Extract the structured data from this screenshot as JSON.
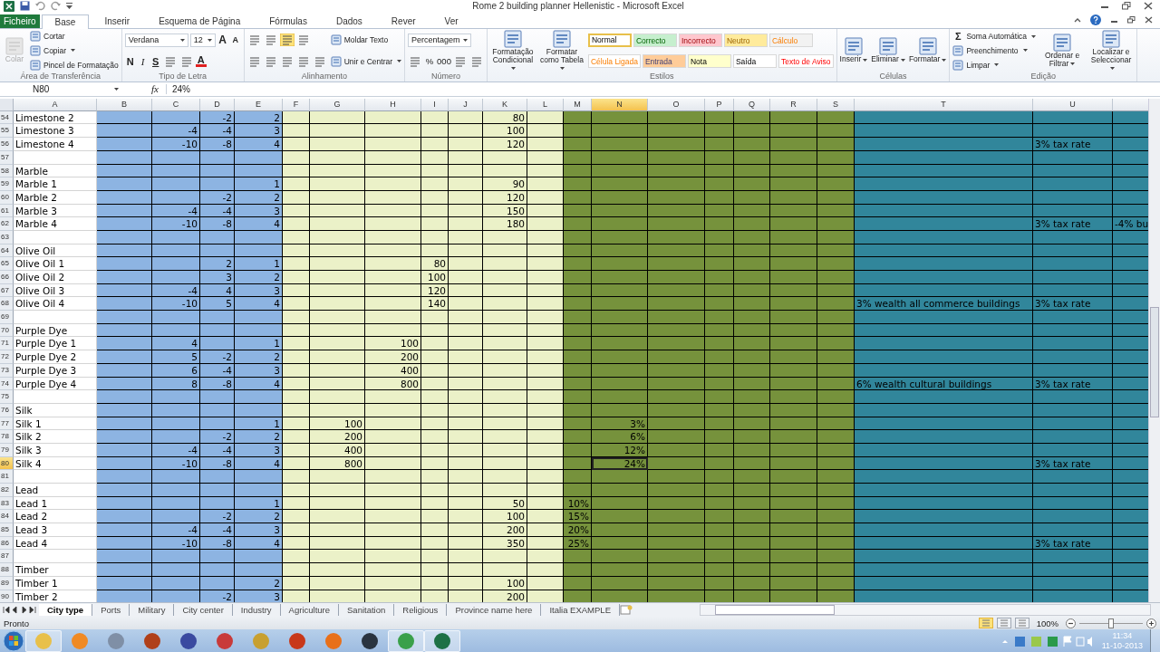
{
  "window": {
    "title": "Rome 2 building planner Hellenistic  -  Microsoft Excel"
  },
  "ribbon_tabs": [
    {
      "label": "Ficheiro",
      "kind": "file",
      "selected": false
    },
    {
      "label": "Base",
      "kind": "tab",
      "selected": true
    },
    {
      "label": "Inserir",
      "kind": "tab",
      "selected": false
    },
    {
      "label": "Esquema de Página",
      "kind": "tab",
      "selected": false
    },
    {
      "label": "Fórmulas",
      "kind": "tab",
      "selected": false
    },
    {
      "label": "Dados",
      "kind": "tab",
      "selected": false
    },
    {
      "label": "Rever",
      "kind": "tab",
      "selected": false
    },
    {
      "label": "Ver",
      "kind": "tab",
      "selected": false
    }
  ],
  "ribbon_groups": [
    {
      "label": "Área de Transferência",
      "columns": [
        [
          [
            {
              "kind": "large",
              "label": "Colar",
              "disabled": true
            }
          ]
        ],
        [
          [
            {
              "kind": "small",
              "label": "Cortar"
            }
          ],
          [
            {
              "kind": "small",
              "label": "Copiar",
              "menu": true
            }
          ],
          [
            {
              "kind": "small",
              "label": "Pincel de Formatação"
            }
          ]
        ]
      ]
    },
    {
      "label": "Tipo de Letra",
      "columns": [
        [
          [
            {
              "kind": "dropdown",
              "value": "Verdana",
              "wide": true
            },
            {
              "kind": "dropdown",
              "value": "12"
            },
            {
              "kind": "grow",
              "label": "A"
            },
            {
              "kind": "shrink",
              "label": "A"
            }
          ],
          [
            {
              "kind": "bold",
              "label": "N"
            },
            {
              "kind": "italic",
              "label": "I"
            },
            {
              "kind": "underline",
              "label": "S"
            },
            {
              "kind": "icon"
            },
            {
              "kind": "icon"
            },
            {
              "kind": "fontcolor",
              "label": "A"
            }
          ]
        ]
      ]
    },
    {
      "label": "Alinhamento",
      "columns": [
        [
          [
            {
              "kind": "icon",
              "selected": false
            },
            {
              "kind": "icon",
              "selected": false
            },
            {
              "kind": "icon",
              "selected": true
            },
            {
              "kind": "icon",
              "selected": false
            }
          ],
          [
            {
              "kind": "icon",
              "selected": false
            },
            {
              "kind": "icon",
              "selected": false
            },
            {
              "kind": "icon",
              "selected": false
            },
            {
              "kind": "icon",
              "selected": false
            },
            {
              "kind": "icon",
              "selected": false
            }
          ]
        ],
        [
          [
            {
              "kind": "small",
              "label": "Moldar Texto"
            }
          ],
          [
            {
              "kind": "small",
              "label": "Unir e Centrar",
              "menu": true
            }
          ]
        ]
      ]
    },
    {
      "label": "Número",
      "columns": [
        [
          [
            {
              "kind": "dropdown",
              "value": "Percentagem",
              "wide": true
            }
          ],
          [
            {
              "kind": "icon"
            },
            {
              "kind": "glyph",
              "label": "%"
            },
            {
              "kind": "glyph",
              "label": "000"
            },
            {
              "kind": "icon"
            },
            {
              "kind": "icon"
            }
          ]
        ]
      ]
    },
    {
      "label": "Estilos",
      "columns": [
        [
          [
            {
              "kind": "large",
              "label": "Formatação Condicional",
              "menu": true
            }
          ]
        ],
        [
          [
            {
              "kind": "large",
              "label": "Formatar como Tabela",
              "menu": true
            }
          ]
        ],
        [
          [
            {
              "kind": "style",
              "label": "Normal",
              "color": "#ffffff",
              "selected": true
            },
            {
              "kind": "style",
              "label": "Correcto",
              "color": "#c6efce",
              "selected": false
            },
            {
              "kind": "style",
              "label": "Incorrecto",
              "color": "#ffc7ce",
              "selected": false
            },
            {
              "kind": "style",
              "label": "Neutro",
              "color": "#ffeb9c",
              "selected": false
            },
            {
              "kind": "style",
              "label": "Cálculo",
              "color": "#f2f2f2",
              "selected": false
            }
          ],
          [
            {
              "kind": "style",
              "label": "Célula Ligada",
              "color": "#ffffff",
              "selected": false
            },
            {
              "kind": "style",
              "label": "Entrada",
              "color": "#ffcc99",
              "selected": false
            },
            {
              "kind": "style",
              "label": "Nota",
              "color": "#ffffcc",
              "selected": false
            },
            {
              "kind": "style",
              "label": "Saída",
              "color": "#ffffff",
              "selected": false
            },
            {
              "kind": "style",
              "label": "Texto de Aviso",
              "color": "#ffffff",
              "selected": false
            }
          ]
        ]
      ]
    },
    {
      "label": "Células",
      "columns": [
        [
          [
            {
              "kind": "large",
              "label": "Inserir",
              "menu": true
            }
          ]
        ],
        [
          [
            {
              "kind": "large",
              "label": "Eliminar",
              "menu": true
            }
          ]
        ],
        [
          [
            {
              "kind": "large",
              "label": "Formatar",
              "menu": true
            }
          ]
        ]
      ]
    },
    {
      "label": "Edição",
      "columns": [
        [
          [
            {
              "kind": "small",
              "label": "Soma Automática",
              "glyph": "Σ",
              "menu": true
            }
          ],
          [
            {
              "kind": "small",
              "label": "Preenchimento",
              "menu": true
            }
          ],
          [
            {
              "kind": "small",
              "label": "Limpar",
              "menu": true
            }
          ]
        ],
        [
          [
            {
              "kind": "large",
              "label": "Ordenar e Filtrar",
              "menu": true
            }
          ]
        ],
        [
          [
            {
              "kind": "large",
              "label": "Localizar e Seleccionar",
              "menu": true
            }
          ]
        ]
      ]
    }
  ],
  "formula_bar": {
    "name_box": "N80",
    "fx": "fx",
    "formula": "24%"
  },
  "columns": [
    {
      "label": "A",
      "selected": false
    },
    {
      "label": "B",
      "selected": false
    },
    {
      "label": "C",
      "selected": false
    },
    {
      "label": "D",
      "selected": false
    },
    {
      "label": "E",
      "selected": false
    },
    {
      "label": "F",
      "selected": false
    },
    {
      "label": "G",
      "selected": false
    },
    {
      "label": "H",
      "selected": false
    },
    {
      "label": "I",
      "selected": false
    },
    {
      "label": "J",
      "selected": false
    },
    {
      "label": "K",
      "selected": false
    },
    {
      "label": "L",
      "selected": false
    },
    {
      "label": "M",
      "selected": false
    },
    {
      "label": "N",
      "selected": true
    },
    {
      "label": "O",
      "selected": false
    },
    {
      "label": "P",
      "selected": false
    },
    {
      "label": "Q",
      "selected": false
    },
    {
      "label": "R",
      "selected": false
    },
    {
      "label": "S",
      "selected": false
    },
    {
      "label": "T",
      "selected": false
    },
    {
      "label": "U",
      "selected": false
    }
  ],
  "rows": [
    {
      "n": "54",
      "selected": false,
      "cells": {
        "A": "Limestone 2",
        "D": "-2",
        "E": "2",
        "K": "80"
      }
    },
    {
      "n": "55",
      "selected": false,
      "cells": {
        "A": "Limestone 3",
        "C": "-4",
        "D": "-4",
        "E": "3",
        "K": "100"
      }
    },
    {
      "n": "56",
      "selected": false,
      "cells": {
        "A": "Limestone 4",
        "C": "-10",
        "D": "-8",
        "E": "4",
        "K": "120",
        "U": "3% tax rate"
      }
    },
    {
      "n": "57",
      "selected": false,
      "cells": {}
    },
    {
      "n": "58",
      "selected": false,
      "cells": {
        "A": "Marble"
      }
    },
    {
      "n": "59",
      "selected": false,
      "cells": {
        "A": "Marble 1",
        "E": "1",
        "K": "90"
      }
    },
    {
      "n": "60",
      "selected": false,
      "cells": {
        "A": "Marble 2",
        "D": "-2",
        "E": "2",
        "K": "120"
      }
    },
    {
      "n": "61",
      "selected": false,
      "cells": {
        "A": "Marble 3",
        "C": "-4",
        "D": "-4",
        "E": "3",
        "K": "150"
      }
    },
    {
      "n": "62",
      "selected": false,
      "cells": {
        "A": "Marble 4",
        "C": "-10",
        "D": "-8",
        "E": "4",
        "K": "180",
        "U": "3% tax rate",
        "column_22": "-4% bu"
      }
    },
    {
      "n": "63",
      "selected": false,
      "cells": {}
    },
    {
      "n": "64",
      "selected": false,
      "cells": {
        "A": "Olive Oil"
      }
    },
    {
      "n": "65",
      "selected": false,
      "cells": {
        "A": "Olive Oil 1",
        "D": "2",
        "E": "1",
        "I": "80"
      }
    },
    {
      "n": "66",
      "selected": false,
      "cells": {
        "A": "Olive Oil 2",
        "D": "3",
        "E": "2",
        "I": "100"
      }
    },
    {
      "n": "67",
      "selected": false,
      "cells": {
        "A": "Olive Oil 3",
        "C": "-4",
        "D": "4",
        "E": "3",
        "I": "120"
      }
    },
    {
      "n": "68",
      "selected": false,
      "cells": {
        "A": "Olive Oil 4",
        "C": "-10",
        "D": "5",
        "E": "4",
        "I": "140",
        "T": "3% wealth all commerce buildings",
        "U": "3% tax rate"
      }
    },
    {
      "n": "69",
      "selected": false,
      "cells": {}
    },
    {
      "n": "70",
      "selected": false,
      "cells": {
        "A": "Purple Dye"
      }
    },
    {
      "n": "71",
      "selected": false,
      "cells": {
        "A": "Purple Dye 1",
        "C": "4",
        "E": "1",
        "H": "100"
      }
    },
    {
      "n": "72",
      "selected": false,
      "cells": {
        "A": "Purple Dye 2",
        "C": "5",
        "D": "-2",
        "E": "2",
        "H": "200"
      }
    },
    {
      "n": "73",
      "selected": false,
      "cells": {
        "A": "Purple Dye 3",
        "C": "6",
        "D": "-4",
        "E": "3",
        "H": "400"
      }
    },
    {
      "n": "74",
      "selected": false,
      "cells": {
        "A": "Purple Dye 4",
        "C": "8",
        "D": "-8",
        "E": "4",
        "H": "800",
        "T": "6% wealth cultural buildings",
        "U": "3% tax rate"
      }
    },
    {
      "n": "75",
      "selected": false,
      "cells": {}
    },
    {
      "n": "76",
      "selected": false,
      "cells": {
        "A": "Silk"
      }
    },
    {
      "n": "77",
      "selected": false,
      "cells": {
        "A": "Silk 1",
        "E": "1",
        "G": "100",
        "N": "3%"
      }
    },
    {
      "n": "78",
      "selected": false,
      "cells": {
        "A": "Silk 2",
        "D": "-2",
        "E": "2",
        "G": "200",
        "N": "6%"
      }
    },
    {
      "n": "79",
      "selected": false,
      "cells": {
        "A": "Silk 3",
        "C": "-4",
        "D": "-4",
        "E": "3",
        "G": "400",
        "N": "12%"
      }
    },
    {
      "n": "80",
      "selected": true,
      "cells": {
        "A": "Silk 4",
        "C": "-10",
        "D": "-8",
        "E": "4",
        "G": "800",
        "N": "24%",
        "U": "3% tax rate"
      }
    },
    {
      "n": "81",
      "selected": false,
      "cells": {}
    },
    {
      "n": "82",
      "selected": false,
      "cells": {
        "A": "Lead"
      }
    },
    {
      "n": "83",
      "selected": false,
      "cells": {
        "A": "Lead 1",
        "E": "1",
        "K": "50",
        "M": "10%"
      }
    },
    {
      "n": "84",
      "selected": false,
      "cells": {
        "A": "Lead 2",
        "D": "-2",
        "E": "2",
        "K": "100",
        "M": "15%"
      }
    },
    {
      "n": "85",
      "selected": false,
      "cells": {
        "A": "Lead 3",
        "C": "-4",
        "D": "-4",
        "E": "3",
        "K": "200",
        "M": "20%"
      }
    },
    {
      "n": "86",
      "selected": false,
      "cells": {
        "A": "Lead 4",
        "C": "-10",
        "D": "-8",
        "E": "4",
        "K": "350",
        "M": "25%",
        "U": "3% tax rate"
      }
    },
    {
      "n": "87",
      "selected": false,
      "cells": {}
    },
    {
      "n": "88",
      "selected": false,
      "cells": {
        "A": "Timber"
      }
    },
    {
      "n": "89",
      "selected": false,
      "cells": {
        "A": "Timber 1",
        "E": "2",
        "K": "100"
      }
    },
    {
      "n": "90",
      "selected": false,
      "cells": {
        "A": "Timber 2",
        "D": "-2",
        "E": "3",
        "K": "200"
      }
    }
  ],
  "sheet_tabs": [
    {
      "label": "City type",
      "selected": true
    },
    {
      "label": "Ports",
      "selected": false
    },
    {
      "label": "Military",
      "selected": false
    },
    {
      "label": "City center",
      "selected": false
    },
    {
      "label": "Industry",
      "selected": false
    },
    {
      "label": "Agriculture",
      "selected": false
    },
    {
      "label": "Sanitation",
      "selected": false
    },
    {
      "label": "Religious",
      "selected": false
    },
    {
      "label": "Province name here",
      "selected": false
    },
    {
      "label": "Italia EXAMPLE",
      "selected": false
    }
  ],
  "status_bar": {
    "status": "Pronto",
    "views": [
      {
        "selected": true
      },
      {
        "selected": false
      },
      {
        "selected": false
      }
    ],
    "zoom": "100%",
    "zoom_level": {
      "level": 0.5
    }
  },
  "taskbar": {
    "apps": [
      {
        "color": "#e8c04a",
        "running": true
      },
      {
        "color": "#f08a24",
        "running": false
      },
      {
        "color": "#7f8fa6",
        "running": false
      },
      {
        "color": "#b0401a",
        "running": false
      },
      {
        "color": "#3a4aa0",
        "running": false
      },
      {
        "color": "#c83a3a",
        "running": false
      },
      {
        "color": "#c8a030",
        "running": false
      },
      {
        "color": "#c8381a",
        "running": false
      },
      {
        "color": "#e8701a",
        "running": false
      },
      {
        "color": "#2a3440",
        "running": false
      },
      {
        "color": "#3aa04a",
        "running": true
      },
      {
        "color": "#1e7145",
        "running": true
      }
    ],
    "time": "11:34",
    "date": "11-10-2013"
  }
}
